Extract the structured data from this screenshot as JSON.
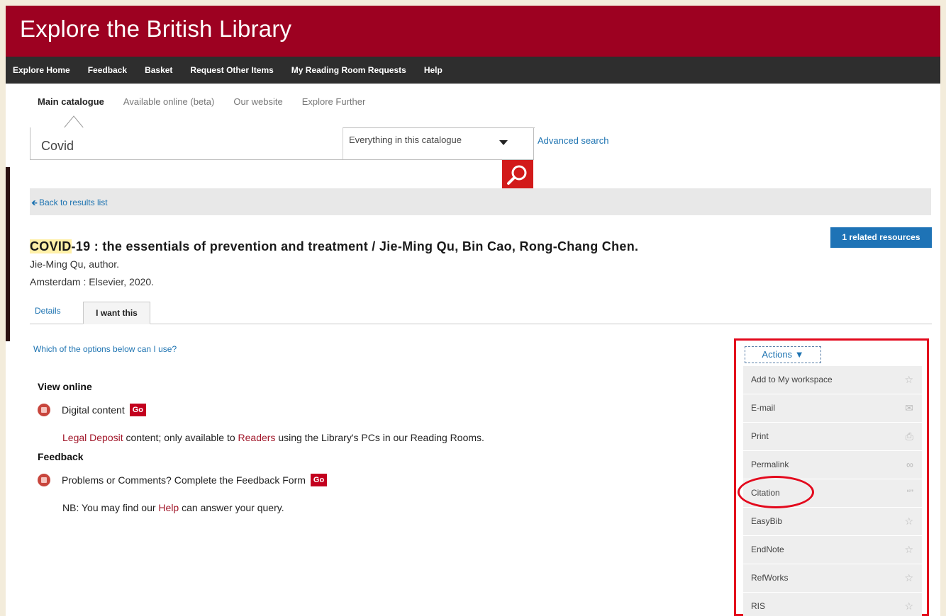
{
  "header": {
    "title": "Explore the British Library"
  },
  "nav": [
    {
      "label": "Explore Home"
    },
    {
      "label": "Feedback"
    },
    {
      "label": "Basket"
    },
    {
      "label": "Request Other Items"
    },
    {
      "label": "My Reading Room Requests"
    },
    {
      "label": "Help"
    }
  ],
  "scope_tabs": [
    {
      "label": "Main catalogue",
      "active": true
    },
    {
      "label": "Available online (beta)"
    },
    {
      "label": "Our website"
    },
    {
      "label": "Explore Further"
    }
  ],
  "search": {
    "value": "Covid",
    "scope_selected": "Everything in this catalogue",
    "advanced_label": "Advanced search"
  },
  "back_link": "Back to results list",
  "record": {
    "title_highlight": "COVID",
    "title_rest": "-19 : the essentials of prevention and treatment / Jie-Ming Qu, Bin Cao, Rong-Chang Chen.",
    "author": "Jie-Ming Qu, author.",
    "publication": "Amsterdam : Elsevier, 2020.",
    "related_button": "1 related resources"
  },
  "detail_tabs": [
    {
      "label": "Details"
    },
    {
      "label": "I want this",
      "active": true
    }
  ],
  "main": {
    "options_link": "Which of the options below can I use?",
    "view_online_heading": "View online",
    "digital_content_label": "Digital content",
    "go_label": "Go",
    "legal_note": {
      "link1": "Legal Deposit",
      "text1": " content; only available to ",
      "link2": "Readers",
      "text2": " using the Library's PCs in our Reading Rooms."
    },
    "feedback_heading": "Feedback",
    "feedback_label": "Problems or Comments? Complete the Feedback Form",
    "help_note": {
      "text1": "NB: You may find our ",
      "link": "Help",
      "text2": " can answer your query."
    }
  },
  "actions": {
    "toggle_label": "Actions",
    "items": [
      {
        "label": "Add to My workspace",
        "icon": "star-icon"
      },
      {
        "label": "E-mail",
        "icon": "envelope-icon"
      },
      {
        "label": "Print",
        "icon": "printer-icon"
      },
      {
        "label": "Permalink",
        "icon": "link-icon"
      },
      {
        "label": "Citation",
        "icon": "quote-icon"
      },
      {
        "label": "EasyBib",
        "icon": "star-icon"
      },
      {
        "label": "EndNote",
        "icon": "star-icon"
      },
      {
        "label": "RefWorks",
        "icon": "star-icon"
      },
      {
        "label": "RIS",
        "icon": "star-icon"
      }
    ]
  },
  "colors": {
    "brand_red": "#9d0121",
    "nav_dark": "#2e2e2e",
    "link_blue": "#1d73b1",
    "highlight_circle": "#e3081c"
  }
}
